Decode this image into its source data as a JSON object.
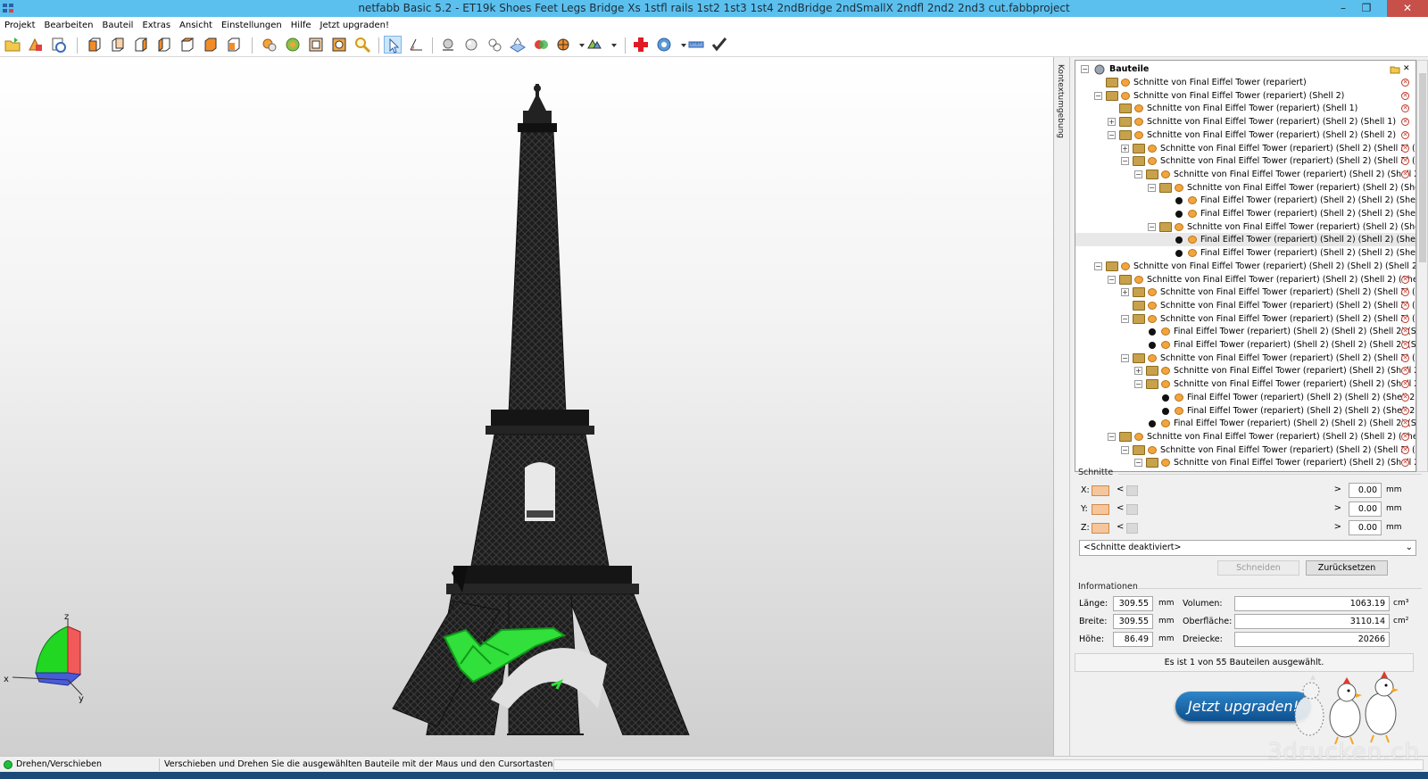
{
  "window": {
    "title": "netfabb Basic 5.2 - ET19k Shoes Feet Legs Bridge Xs 1stfl rails 1st2 1st3 1st4 2ndBridge 2ndSmallX 2ndfl 2nd2 2nd3 cut.fabbproject",
    "minimize": "–",
    "restore": "❐",
    "close": "✕"
  },
  "menu": [
    "Projekt",
    "Bearbeiten",
    "Bauteil",
    "Extras",
    "Ansicht",
    "Einstellungen",
    "Hilfe",
    "Jetzt upgraden!"
  ],
  "sidebar_tab": "Kontextumgebung",
  "tree": {
    "root": "Bauteile",
    "rows": [
      {
        "label": "Schnitte von Final Eiffel Tower (repariert)",
        "level": 1,
        "kind": "folder",
        "exp": "",
        "del": true
      },
      {
        "label": "Schnitte von Final Eiffel Tower (repariert) (Shell 2)",
        "level": 1,
        "kind": "folder",
        "exp": "−",
        "del": true
      },
      {
        "label": "Schnitte von Final Eiffel Tower (repariert) (Shell 1)",
        "level": 2,
        "kind": "folder",
        "exp": "",
        "del": true
      },
      {
        "label": "Schnitte von Final Eiffel Tower (repariert) (Shell 2) (Shell 1)",
        "level": 2,
        "kind": "folder",
        "exp": "+",
        "del": true
      },
      {
        "label": "Schnitte von Final Eiffel Tower (repariert) (Shell 2) (Shell 2)",
        "level": 2,
        "kind": "folder",
        "exp": "−",
        "del": true
      },
      {
        "label": "Schnitte von Final Eiffel Tower (repariert) (Shell 2) (Shell 2) (Shell",
        "level": 3,
        "kind": "folder",
        "exp": "+",
        "del": true
      },
      {
        "label": "Schnitte von Final Eiffel Tower (repariert) (Shell 2) (Shell 2) (Shell",
        "level": 3,
        "kind": "folder",
        "exp": "−",
        "del": true
      },
      {
        "label": "Schnitte von Final Eiffel Tower (repariert) (Shell 2) (Shell 2) (Shell 2) (S",
        "level": 4,
        "kind": "folder",
        "exp": "−",
        "del": true
      },
      {
        "label": "Schnitte von Final Eiffel Tower (repariert) (Shell 2) (Shell 2) (Shell 2",
        "level": 5,
        "kind": "folder",
        "exp": "−",
        "del": false
      },
      {
        "label": "Final Eiffel Tower (repariert) (Shell 2) (Shell 2) (Shell 2)",
        "level": 6,
        "kind": "part",
        "exp": "",
        "del": false
      },
      {
        "label": "Final Eiffel Tower (repariert) (Shell 2) (Shell 2) (Shell 2)",
        "level": 6,
        "kind": "part",
        "exp": "",
        "del": false
      },
      {
        "label": "Schnitte von Final Eiffel Tower (repariert) (Shell 2) (Shell 2) (Shell 2",
        "level": 5,
        "kind": "folder",
        "exp": "−",
        "del": false
      },
      {
        "label": "Final Eiffel Tower (repariert) (Shell 2) (Shell 2) (Shell 2)",
        "level": 6,
        "kind": "part",
        "exp": "",
        "del": false,
        "selected": true
      },
      {
        "label": "Final Eiffel Tower (repariert) (Shell 2) (Shell 2) (Shell 2)",
        "level": 6,
        "kind": "part",
        "exp": "",
        "del": false
      },
      {
        "label": "Schnitte von Final Eiffel Tower (repariert) (Shell 2) (Shell 2) (Shell 2) (Sh",
        "level": 1,
        "kind": "folder",
        "exp": "−",
        "del": false
      },
      {
        "label": "Schnitte von Final Eiffel Tower (repariert) (Shell 2) (Shell 2) (Shell 2)",
        "level": 2,
        "kind": "folder",
        "exp": "−",
        "del": true
      },
      {
        "label": "Schnitte von Final Eiffel Tower (repariert) (Shell 2) (Shell 2) (Shell",
        "level": 3,
        "kind": "folder",
        "exp": "+",
        "del": true
      },
      {
        "label": "Schnitte von Final Eiffel Tower (repariert) (Shell 2) (Shell 2) (Shell",
        "level": 3,
        "kind": "folder",
        "exp": "",
        "del": true
      },
      {
        "label": "Schnitte von Final Eiffel Tower (repariert) (Shell 2) (Shell 2) (Shell",
        "level": 3,
        "kind": "folder",
        "exp": "−",
        "del": true
      },
      {
        "label": "Final Eiffel Tower (repariert) (Shell 2) (Shell 2) (Shell 2) (Shell",
        "level": 4,
        "kind": "part",
        "exp": "",
        "del": true
      },
      {
        "label": "Final Eiffel Tower (repariert) (Shell 2) (Shell 2) (Shell 2) (Shell",
        "level": 4,
        "kind": "part",
        "exp": "",
        "del": true
      },
      {
        "label": "Schnitte von Final Eiffel Tower (repariert) (Shell 2) (Shell 2) (Shell",
        "level": 3,
        "kind": "folder",
        "exp": "−",
        "del": true
      },
      {
        "label": "Schnitte von Final Eiffel Tower (repariert) (Shell 2) (Shell 2) (Shell 2) (S",
        "level": 4,
        "kind": "folder",
        "exp": "+",
        "del": true
      },
      {
        "label": "Schnitte von Final Eiffel Tower (repariert) (Shell 2) (Shell 2) (Shell 2) (S",
        "level": 4,
        "kind": "folder",
        "exp": "−",
        "del": true
      },
      {
        "label": "Final Eiffel Tower (repariert) (Shell 2) (Shell 2) (Shell 2) (Sh",
        "level": 5,
        "kind": "part",
        "exp": "",
        "del": true
      },
      {
        "label": "Final Eiffel Tower (repariert) (Shell 2) (Shell 2) (Shell 2) (Sh",
        "level": 5,
        "kind": "part",
        "exp": "",
        "del": true
      },
      {
        "label": "Final Eiffel Tower (repariert) (Shell 2) (Shell 2) (Shell 2) (Shell",
        "level": 4,
        "kind": "part",
        "exp": "",
        "del": true
      },
      {
        "label": "Schnitte von Final Eiffel Tower (repariert) (Shell 2) (Shell 2) (Shell 2)",
        "level": 2,
        "kind": "folder",
        "exp": "−",
        "del": true
      },
      {
        "label": "Schnitte von Final Eiffel Tower (repariert) (Shell 2) (Shell 2) (Shell",
        "level": 3,
        "kind": "folder",
        "exp": "−",
        "del": true
      },
      {
        "label": "Schnitte von Final Eiffel Tower (repariert) (Shell 2) (Shell 2) (Shell 2) (S",
        "level": 4,
        "kind": "folder",
        "exp": "−",
        "del": true
      }
    ]
  },
  "schnitte": {
    "title": "Schnitte",
    "x": {
      "label": "X:",
      "value": "0.00",
      "unit": "mm"
    },
    "y": {
      "label": "Y:",
      "value": "0.00",
      "unit": "mm"
    },
    "z": {
      "label": "Z:",
      "value": "0.00",
      "unit": "mm"
    },
    "arrow_left": "<",
    "arrow_right": ">",
    "mode": "<Schnitte deaktiviert>",
    "cut_button": "Schneiden",
    "reset_button": "Zurücksetzen"
  },
  "info": {
    "title": "Informationen",
    "length_label": "Länge:",
    "length": "309.55",
    "length_unit": "mm",
    "width_label": "Breite:",
    "width": "309.55",
    "width_unit": "mm",
    "height_label": "Höhe:",
    "height": "86.49",
    "height_unit": "mm",
    "volume_label": "Volumen:",
    "volume": "1063.19",
    "volume_unit": "cm³",
    "surface_label": "Oberfläche:",
    "surface": "3110.14",
    "surface_unit": "cm²",
    "triangles_label": "Dreiecke:",
    "triangles": "20266"
  },
  "selection_status": "Es ist 1 von 55 Bauteilen ausgewählt.",
  "upgrade": "Jetzt upgraden!",
  "statusbar": {
    "mode": "Drehen/Verschieben",
    "hint": "Verschieben und Drehen Sie die ausgewählten Bauteile mit der Maus und den Cursortasten"
  },
  "axes": {
    "x": "x",
    "y": "y",
    "z": "z"
  },
  "watermark": "3drucken.ch",
  "colors": {
    "accent": "#5bc0ee",
    "selection": "#2fdc2f",
    "model": "#1d1d1d",
    "upgrade": "#0d4f8e"
  }
}
